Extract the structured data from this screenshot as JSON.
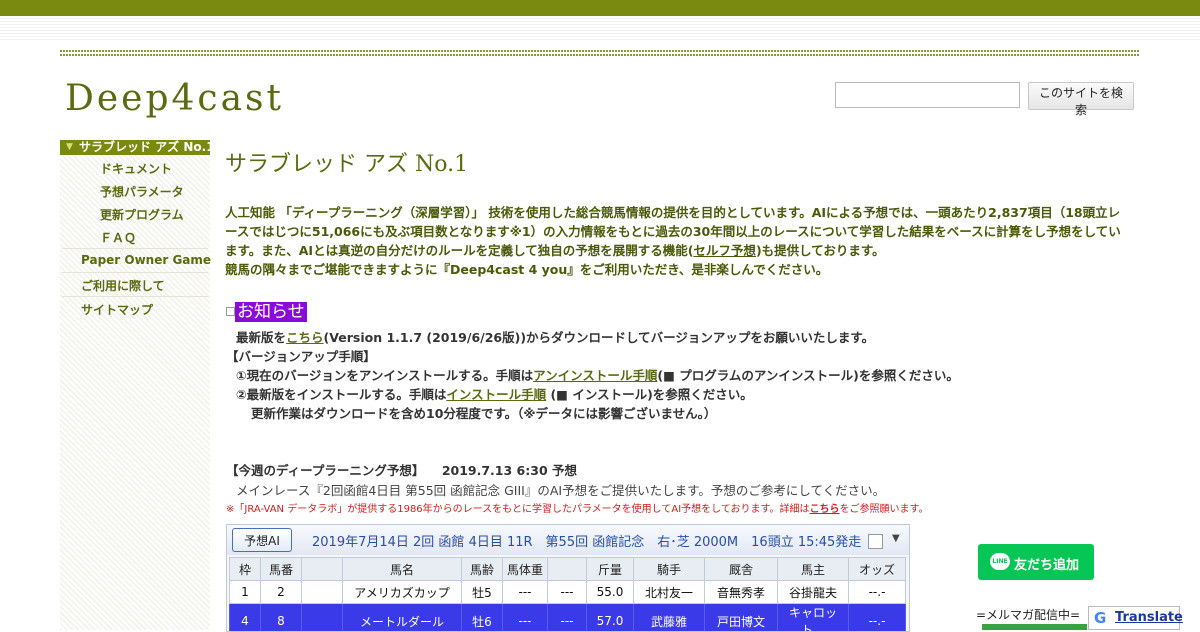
{
  "site": {
    "title": "Deep4cast"
  },
  "search": {
    "placeholder": "",
    "button_label": "このサイトを検索"
  },
  "sidebar": {
    "active_label": "サラブレッド アズ No.1",
    "sub_items": [
      "ドキュメント",
      "予想パラメータ",
      "更新プログラム",
      "ＦＡＱ"
    ],
    "items": [
      "Paper Owner Game",
      "ご利用に際して",
      "サイトマップ"
    ]
  },
  "main": {
    "title": "サラブレッド アズ No.1",
    "intro_a": "人工知能 「ディープラーニング（深層学習）」 技術を使用した総合競馬情報の提供を目的としています。AIによる予想では、一頭あたり2,837項目（18頭立レースではじつに51,066にも及ぶ項目数となります※1）の入力情報をもとに過去の30年間以上のレースについて学習した結果をベースに計算をし予想をしています。また、AIとは真逆の自分だけのルールを定義して独自の予想を展開する機能(",
    "intro_link": "セルフ予想",
    "intro_b": ")も提供しております。",
    "intro_c": "競馬の隅々までご堪能できますように『Deep4cast 4 you』をご利用いただき、是非楽しんでください。"
  },
  "notice": {
    "heading": "お知らせ",
    "l1_a": "最新版を",
    "l1_link": "こちら",
    "l1_b": "(Version 1.1.7 (2019/6/26版))からダウンロードしてバージョンアップをお願いいたします。",
    "l2": "【バージョンアップ手順】",
    "l3_a": "①現在のバージョンをアンインストールする。手順は",
    "l3_link": "アンインストール手順",
    "l3_b": "(■ プログラムのアンインストール)を参照ください。",
    "l4_a": "②最新版をインストールする。手順は",
    "l4_link": "インストール手順",
    "l4_b": " (■ インストール)を参照ください。",
    "l5": "更新作業はダウンロードを含め10分程度です。（※データには影響ございません。）"
  },
  "weekly": {
    "heading": "【今週のディープラーニング予想】",
    "date": "2019.7.13 6:30 予想",
    "desc": "メインレース『2回函館4日目 第55回 函館記念 GIII』のAI予想をご提供いたします。予想のご参考にしてください。",
    "note_a": "※「JRA-VAN データラボ」が提供する1986年からのレースをもとに学習したパラメータを使用してAI予想をしております。詳細は",
    "note_link": "こちら",
    "note_b": "をご参照願います。"
  },
  "race_table": {
    "button_label": "予想AI",
    "race_title": "2019年7月14日 2回 函館 4日目 11R　第55回 函館記念　右･芝 2000M　16頭立 15:45発走",
    "headers": [
      "枠",
      "馬番",
      "",
      "馬名",
      "馬齢",
      "馬体重",
      "",
      "斤量",
      "騎手",
      "厩舎",
      "馬主",
      "オッズ"
    ],
    "rows": [
      [
        "1",
        "2",
        "",
        "アメリカズカップ",
        "牡5",
        "---",
        "---",
        "55.0",
        "北村友一",
        "音無秀孝",
        "谷掛龍夫",
        "--.-"
      ],
      [
        "4",
        "8",
        "",
        "メートルダール",
        "牡6",
        "---",
        "---",
        "57.0",
        "武藤雅",
        "戸田博文",
        "キャロット…",
        "--.-"
      ]
    ]
  },
  "widgets": {
    "line_button": "友だち追加",
    "line_icon": "LINE",
    "mailmag": "=メルマガ配信中=",
    "translate": "Translate",
    "translate_icon": "G"
  },
  "colors": {
    "brand": "#7a8a10",
    "notice": "#8a0ad8",
    "line": "#06c755",
    "selected_row": "#3a3ae8"
  }
}
